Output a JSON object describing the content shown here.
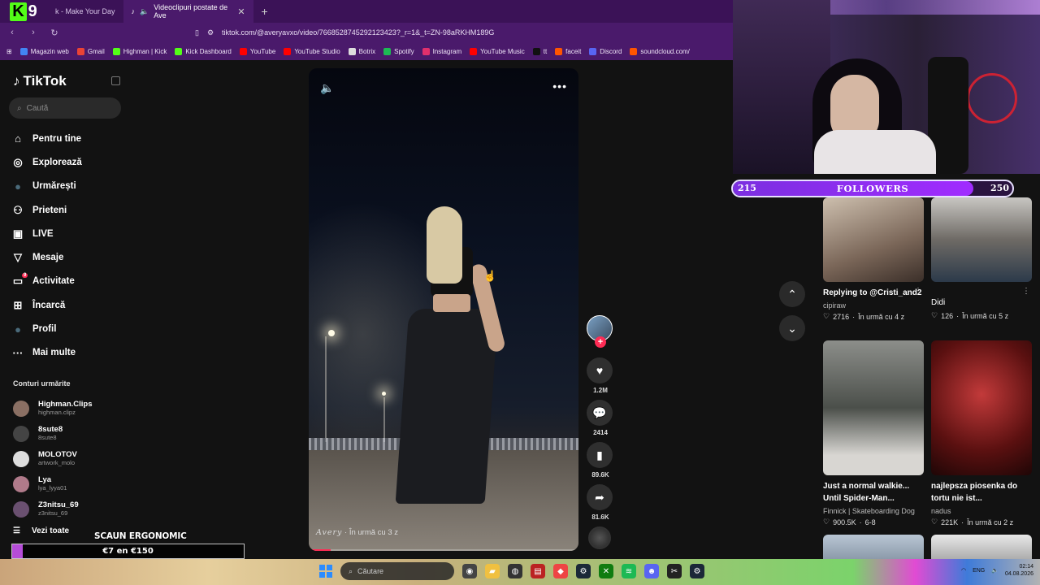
{
  "browser": {
    "tabs": [
      {
        "label": "k - Make Your Day",
        "active": false
      },
      {
        "label": "Videoclipuri postate de Ave",
        "active": true
      }
    ],
    "url": "tiktok.com/@averyavxo/video/7668528745292123423?_r=1&_t=ZN-98aRKHM189G",
    "bookmarks": [
      {
        "label": "Magazin web",
        "color": "#4285f4"
      },
      {
        "label": "Gmail",
        "color": "#ea4335"
      },
      {
        "label": "Highman | Kick",
        "color": "#53fc18"
      },
      {
        "label": "Kick Dashboard",
        "color": "#53fc18"
      },
      {
        "label": "YouTube",
        "color": "#ff0000"
      },
      {
        "label": "YouTube Studio",
        "color": "#ff0000"
      },
      {
        "label": "Botrix",
        "color": "#dddddd"
      },
      {
        "label": "Spotify",
        "color": "#1db954"
      },
      {
        "label": "Instagram",
        "color": "#e1306c"
      },
      {
        "label": "YouTube Music",
        "color": "#ff0000"
      },
      {
        "label": "tt",
        "color": "#111111"
      },
      {
        "label": "faceit",
        "color": "#ff5500"
      },
      {
        "label": "Discord",
        "color": "#5865f2"
      },
      {
        "label": "soundcloud.com/",
        "color": "#ff5500"
      }
    ]
  },
  "tiktok": {
    "logo": "TikTok",
    "search_placeholder": "Caută",
    "nav": [
      {
        "label": "Pentru tine",
        "icon": "home-icon",
        "glyph": "⌂"
      },
      {
        "label": "Explorează",
        "icon": "compass-icon",
        "glyph": "◎"
      },
      {
        "label": "Urmărești",
        "icon": "following-avatar-icon",
        "glyph": "●"
      },
      {
        "label": "Prieteni",
        "icon": "friends-icon",
        "glyph": "⚇"
      },
      {
        "label": "LIVE",
        "icon": "live-icon",
        "glyph": "▣"
      },
      {
        "label": "Mesaje",
        "icon": "messages-icon",
        "glyph": "▽"
      },
      {
        "label": "Activitate",
        "icon": "activity-icon",
        "glyph": "▭",
        "badge": "9"
      },
      {
        "label": "Încarcă",
        "icon": "upload-icon",
        "glyph": "⊞"
      },
      {
        "label": "Profil",
        "icon": "profile-avatar-icon",
        "glyph": "●"
      },
      {
        "label": "Mai multe",
        "icon": "more-icon",
        "glyph": "···"
      }
    ],
    "following_title": "Conturi urmărite",
    "following": [
      {
        "name": "Highman.Clips",
        "handle": "highman.clipz"
      },
      {
        "name": "8sute8",
        "handle": "8sute8"
      },
      {
        "name": "MOLOTOV",
        "handle": "artwork_molo"
      },
      {
        "name": "Lya",
        "handle": "lya_lyya01"
      },
      {
        "name": "Z3nitsu_69",
        "handle": "z3nitsu_69"
      }
    ],
    "see_all": "Vezi toate"
  },
  "video": {
    "author": "Avery",
    "time": " · În urmă cu 3 z",
    "progress": 0.08,
    "likes": "1.2M",
    "comments": "2414",
    "saves": "89.6K",
    "shares": "81.6K"
  },
  "recommended": [
    {
      "title": "Replying to @Cristi_and2",
      "author": "cipiraw",
      "likes": "2716",
      "age": "În urmă cu 4 z"
    },
    {
      "title": "Didi",
      "author": "",
      "likes": "126",
      "age": "În urmă cu 5 z"
    },
    {
      "title": "Just a normal walkie... Until Spider-Man...",
      "author": "Finnick | Skateboarding Dog",
      "likes": "900.5K",
      "age": "6-8"
    },
    {
      "title": "najlepsza piosenka do tortu nie ist...",
      "author": "nadus",
      "likes": "221K",
      "age": "În urmă cu 2 z"
    }
  ],
  "stream": {
    "followers_current": "215",
    "followers_label": "FOLLOWERS",
    "followers_goal": "250",
    "followers_fraction": 0.86,
    "chair_label": "SCAUN ERGONOMIC",
    "chair_text": "€7 en €150",
    "chair_fraction": 0.047
  },
  "taskbar": {
    "search_placeholder": "Căutare",
    "lang": "ENG",
    "time": "02:14",
    "date": "04.08.2026"
  }
}
